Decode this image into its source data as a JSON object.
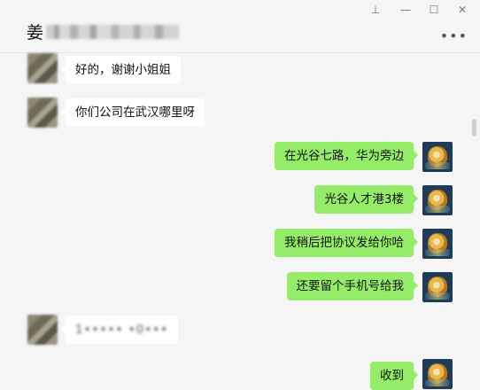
{
  "window": {
    "title": "姜",
    "pin_glyph": "⊥",
    "minimize_glyph": "—",
    "maximize_glyph": "☐",
    "close_glyph": "✕",
    "more_glyph": "•••"
  },
  "messages": [
    {
      "side": "left",
      "text": "好的，谢谢小姐姐"
    },
    {
      "side": "left",
      "text": "你们公司在武汉哪里呀"
    },
    {
      "side": "right",
      "text": "在光谷七路，华为旁边"
    },
    {
      "side": "right",
      "text": "光谷人才港3楼"
    },
    {
      "side": "right",
      "text": "我稍后把协议发给你哈"
    },
    {
      "side": "right",
      "text": "还要留个手机号给我"
    },
    {
      "side": "left",
      "text": "1••••• •0•••",
      "blurred": true
    },
    {
      "side": "right",
      "text": "收到"
    }
  ],
  "colors": {
    "self_bubble": "#95ec69",
    "other_bubble": "#ffffff",
    "background": "#f5f5f5"
  }
}
